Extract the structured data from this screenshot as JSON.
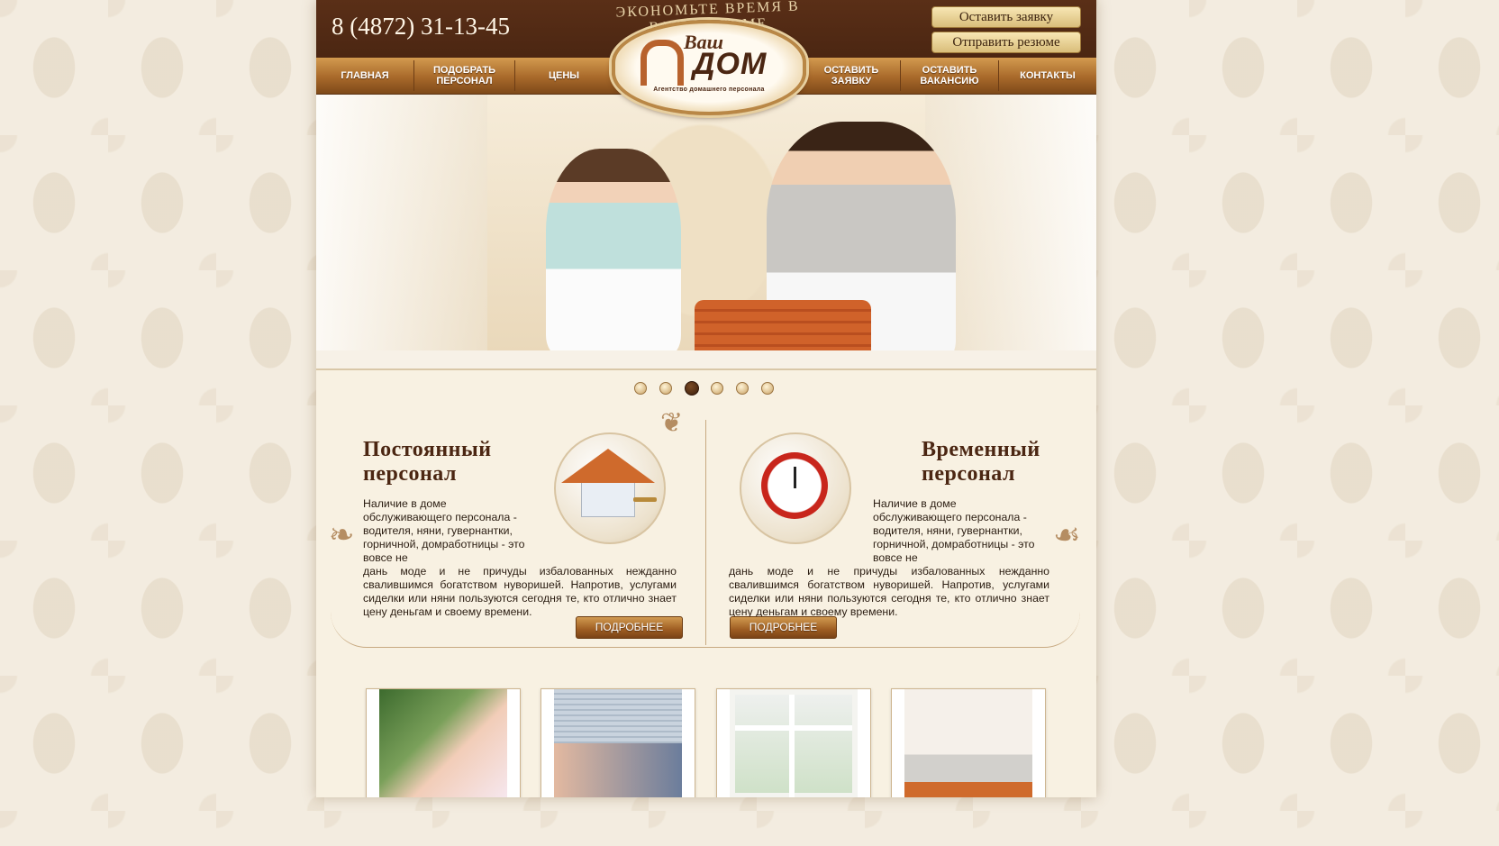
{
  "header": {
    "phone": "8 (4872) 31-13-45",
    "slogan": "Экономьте время в вашем доме",
    "buttons": {
      "request": "Оставить заявку",
      "resume": "Отправить резюме"
    }
  },
  "logo": {
    "line1": "Ваш",
    "line2": "ДОМ",
    "subtitle": "Агентство домашнего персонала"
  },
  "nav": {
    "items": [
      {
        "label": "Главная"
      },
      {
        "label": "Подобрать персонал"
      },
      {
        "label": "Цены"
      },
      {
        "label": "Оставить заявку"
      },
      {
        "label": "Оставить вакансию"
      },
      {
        "label": "Контакты"
      }
    ]
  },
  "slider": {
    "dot_count": 6,
    "active_index": 2
  },
  "services": {
    "permanent": {
      "title_line1": "Постоянный",
      "title_line2": "персонал",
      "text_narrow": "Наличие в доме обслуживающего персонала - водителя, няни, гувернантки, горничной, домработницы - это вовсе не",
      "text_wide": "дань моде и не причуды избалованных нежданно свалившимся богатством нуворишей. Напротив, услугами сиделки или няни пользуются сегодня те, кто отлично знает цену деньгам и своему времени.",
      "more_label": "Подробнее",
      "icon": "house-with-key-icon"
    },
    "temporary": {
      "title_line1": "Временный",
      "title_line2": "персонал",
      "text_narrow": "Наличие в доме обслуживающего персонала - водителя, няни, гувернантки, горничной, домработницы - это вовсе не",
      "text_wide": "дань моде и не причуды избалованных нежданно свалившимся богатством нуворишей. Напротив, услугами сиделки или няни пользуются сегодня те, кто отлично знает цену деньгам и своему времени.",
      "more_label": "Подробнее",
      "icon": "alarm-clock-icon"
    }
  },
  "colors": {
    "header_brown": "#4b2612",
    "nav_gold": "#a8692a",
    "page_cream": "#f8f1e2",
    "button_gold": "#d9bd7a"
  }
}
